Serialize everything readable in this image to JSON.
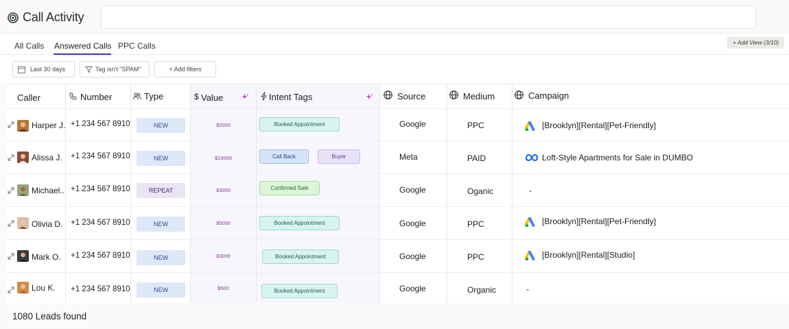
{
  "header": {
    "title": "Call Activity"
  },
  "tabs": [
    {
      "label": "All Calls"
    },
    {
      "label": "Answered Calls"
    },
    {
      "label": "PPC Calls"
    }
  ],
  "add_view_label": "+ Add View (3/10)",
  "filters": {
    "date": "Last 30 days",
    "tag": "Tag isn't \"SPAM\"",
    "add": "+ Add filters"
  },
  "columns": {
    "caller": "Caller",
    "number": "Number",
    "type": "Type",
    "value": "Value",
    "intent_tags": "Intent Tags",
    "source": "Source",
    "medium": "Medium",
    "campaign": "Campaign"
  },
  "rows": [
    {
      "caller": "Harper J.",
      "number": "+1 234 567 8910",
      "type": "NEW",
      "value": "$2000",
      "tags": [
        "Booked Appointment"
      ],
      "source": "Google",
      "medium": "PPC",
      "campaign": "[Brooklyn][Rental][Pet-Friendly]",
      "campaign_icon": "google-ads-icon"
    },
    {
      "caller": "Alissa J.",
      "number": "+1 234 567 8910",
      "type": "NEW",
      "value": "$15000",
      "tags": [
        "Call Back",
        "Buyer"
      ],
      "source": "Meta",
      "medium": "PAID",
      "campaign": "Loft-Style Apartments for Sale in DUMBO",
      "campaign_icon": "meta-icon"
    },
    {
      "caller": "Michael..",
      "number": "+1 234 567 8910",
      "type": "REPEAT",
      "value": "$3000",
      "tags": [
        "Confirmed Sale"
      ],
      "source": "Google",
      "medium": "Oganic",
      "campaign": "-",
      "campaign_icon": ""
    },
    {
      "caller": "Olivia D.",
      "number": "+1 234 567 8910",
      "type": "NEW",
      "value": "$5000",
      "tags": [
        "Booked Appointment"
      ],
      "source": "Google",
      "medium": "PPC",
      "campaign": "[Brooklyn][Rental][Pet-Friendly]",
      "campaign_icon": "google-ads-icon"
    },
    {
      "caller": "Mark O.",
      "number": "+1 234 567 8910",
      "type": "NEW",
      "value": "$3000",
      "tags": [
        "Booked Appointment"
      ],
      "source": "Google",
      "medium": "PPC",
      "campaign": "[Brooklyn][Rental][Studio]",
      "campaign_icon": "google-ads-icon"
    },
    {
      "caller": "Lou K.",
      "number": "+1 234 567 8910",
      "type": "NEW",
      "value": "$500",
      "tags": [
        "Booked Appointment"
      ],
      "source": "Google",
      "medium": "Organic",
      "campaign": "-",
      "campaign_icon": ""
    }
  ],
  "footer": {
    "leads_count": "1080 Leads found"
  },
  "colors": {
    "accent": "#3b35c9",
    "type_new_bg": "#dde8f8",
    "type_repeat_bg": "#ebe4f5",
    "tag_booked_bg": "#d9f3f0",
    "tag_callback_bg": "#d6e4fa",
    "tag_buyer_bg": "#e8e2f8",
    "tag_confirmed_bg": "#dcf5d6",
    "value_text": "#8a3a9a"
  }
}
